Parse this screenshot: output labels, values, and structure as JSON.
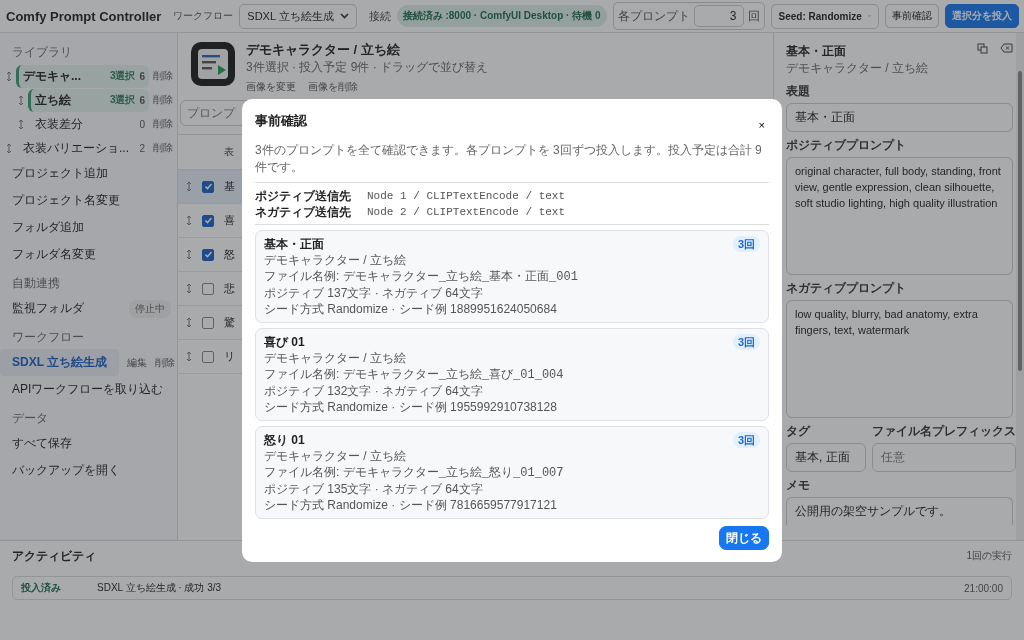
{
  "app_title": "Comfy Prompt Controller",
  "header": {
    "workflow_label": "ワークフロー",
    "workflow_value": "SDXL 立ち絵生成",
    "connect_link": "接続",
    "status": "接続済み :8000 · ComfyUI Desktop · 待機 0",
    "repeat_label": "各プロンプト",
    "repeat_value": "3",
    "repeat_unit": "回",
    "seed_value": "Seed: Randomize",
    "preview_button": "事前確認",
    "submit_button": "選択分を投入"
  },
  "sidebar": {
    "library_heading": "ライブラリ",
    "library": [
      {
        "label": "デモキャ...",
        "badge": "3選択",
        "count": "6",
        "action": "削除",
        "selected": true,
        "children": [
          {
            "label": "立ち絵",
            "badge": "3選択",
            "count": "6",
            "action": "削除",
            "selected": true
          },
          {
            "label": "衣装差分",
            "count": "0",
            "action": "削除",
            "selected": false
          }
        ]
      },
      {
        "label": "衣装バリエーショ...",
        "count": "2",
        "action": "削除",
        "selected": false
      }
    ],
    "library_actions": [
      "プロジェクト追加",
      "プロジェクト名変更",
      "フォルダ追加",
      "フォルダ名変更"
    ],
    "auto_heading": "自動連携",
    "watch_label": "監視フォルダ",
    "watch_status": "停止中",
    "workflow_heading": "ワークフロー",
    "workflows": [
      {
        "label": "SDXL 立ち絵生成",
        "edit": "編集",
        "delete": "削除",
        "selected": true
      }
    ],
    "import_workflow": "APIワークフローを取り込む",
    "data_heading": "データ",
    "data_actions": [
      "すべて保存",
      "バックアップを開く"
    ]
  },
  "main": {
    "title": "デモキャラクター / 立ち絵",
    "subtitle": "3件選択 · 投入予定 9件 · ドラッグで並び替え",
    "image_buttons": [
      "画像を変更",
      "画像を削除"
    ],
    "search_placeholder": "プロンプ",
    "column_1": "表",
    "rows": [
      {
        "title": "基",
        "checked": true,
        "selected": true
      },
      {
        "title": "喜",
        "checked": true,
        "selected": false
      },
      {
        "title": "怒",
        "checked": true,
        "selected": false
      },
      {
        "title": "悲",
        "checked": false,
        "selected": false
      },
      {
        "title": "驚",
        "checked": false,
        "selected": false
      },
      {
        "title": "リ",
        "checked": false,
        "selected": false
      }
    ]
  },
  "editor": {
    "title": "基本・正面",
    "subtitle": "デモキャラクター / 立ち絵",
    "title_label": "表題",
    "title_value": "基本・正面",
    "positive_label": "ポジティブプロンプト",
    "positive_value": "original character, full body, standing, front view, gentle expression, clean silhouette, soft studio lighting, high quality illustration",
    "negative_label": "ネガティブプロンプト",
    "negative_value": "low quality, blurry, bad anatomy, extra fingers, text, watermark",
    "tag_label": "タグ",
    "tag_value": "基本, 正面",
    "prefix_label": "ファイル名プレフィックス",
    "prefix_placeholder": "任意",
    "memo_label": "メモ",
    "memo_value": "公開用の架空サンプルです。"
  },
  "activity": {
    "title": "アクティビティ",
    "summary": "1回の実行",
    "entries": [
      {
        "status": "投入済み",
        "detail": "SDXL 立ち絵生成 · 成功 3/3",
        "time": "21:00:00"
      }
    ]
  },
  "dialog": {
    "title": "事前確認",
    "close": "×",
    "description": "3件のプロンプトを全て確認できます。各プロンプトを 3回ずつ投入します。投入予定は合計 9件です。",
    "targets": [
      {
        "label": "ポジティブ送信先",
        "value": "Node 1 / CLIPTextEncode / text"
      },
      {
        "label": "ネガティブ送信先",
        "value": "Node 2 / CLIPTextEncode / text"
      }
    ],
    "cards": [
      {
        "title": "基本・正面",
        "path": "デモキャラクター / 立ち絵",
        "file_label": "ファイル名例:",
        "file": "デモキャラクター_立ち絵_基本・正面_001",
        "counts": "ポジティブ 137文字 · ネガティブ 64文字",
        "seed": "シード方式 Randomize · シード例 1889951624050684",
        "badge": "3回"
      },
      {
        "title": "喜び 01",
        "path": "デモキャラクター / 立ち絵",
        "file_label": "ファイル名例:",
        "file": "デモキャラクター_立ち絵_喜び_01_004",
        "counts": "ポジティブ 132文字 · ネガティブ 64文字",
        "seed": "シード方式 Randomize · シード例 1955992910738128",
        "badge": "3回"
      },
      {
        "title": "怒り 01",
        "path": "デモキャラクター / 立ち絵",
        "file_label": "ファイル名例:",
        "file": "デモキャラクター_立ち絵_怒り_01_007",
        "counts": "ポジティブ 135文字 · ネガティブ 64文字",
        "seed": "シード方式 Randomize · シード例 7816659577917121",
        "badge": "3回"
      }
    ],
    "close_button": "閉じる"
  }
}
